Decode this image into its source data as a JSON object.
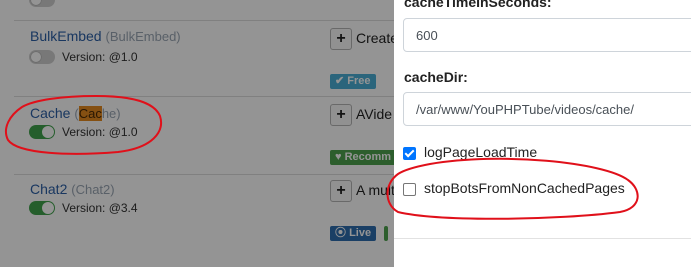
{
  "plugins": [
    {
      "name": "BulkEmbed",
      "alias": "(BulkEmbed)",
      "version": "Version: @1.0",
      "enabled": false,
      "description": "Create",
      "badge": {
        "icon": "check-icon",
        "label": "Free"
      }
    },
    {
      "name": "Cache",
      "alias_open": "(",
      "alias_highlight": "Cac",
      "alias_rest": "he)",
      "version": "Version: @1.0",
      "enabled": true,
      "description": "AVide",
      "badge": {
        "icon": "heart-icon",
        "label": "Recomm"
      }
    },
    {
      "name": "Chat2",
      "alias": "(Chat2)",
      "version": "Version: @3.4",
      "enabled": true,
      "description": "A mult",
      "badge": {
        "icon": "broadcast-icon",
        "label": "Live"
      }
    }
  ],
  "settings": {
    "cache_time_label": "cacheTimeInSeconds:",
    "cache_time_value": "600",
    "cache_dir_label": "cacheDir:",
    "cache_dir_value": "/var/www/YouPHPTube/videos/cache/",
    "log_page_load": {
      "label": "logPageLoadTime",
      "checked": true
    },
    "stop_bots": {
      "label": "stopBotsFromNonCachedPages",
      "checked": false
    }
  },
  "colors": {
    "accent": "#0075ff",
    "toggle_on": "#41a34c",
    "annotation": "#e0101a",
    "highlight": "#e58a1f"
  }
}
